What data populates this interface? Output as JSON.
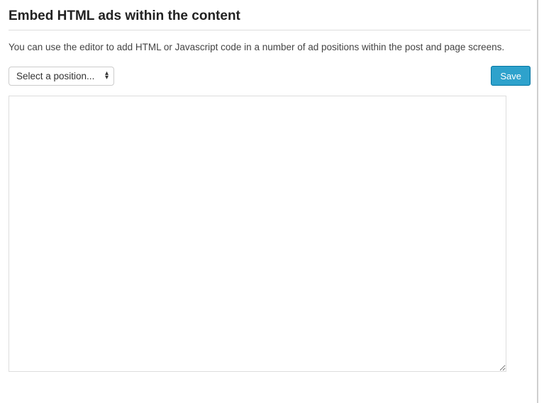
{
  "heading": "Embed HTML ads within the content",
  "description": "You can use the editor to add HTML or Javascript code in a number of ad positions within the post and page screens.",
  "select": {
    "placeholder": "Select a position...",
    "value": ""
  },
  "save_label": "Save",
  "editor_value": ""
}
